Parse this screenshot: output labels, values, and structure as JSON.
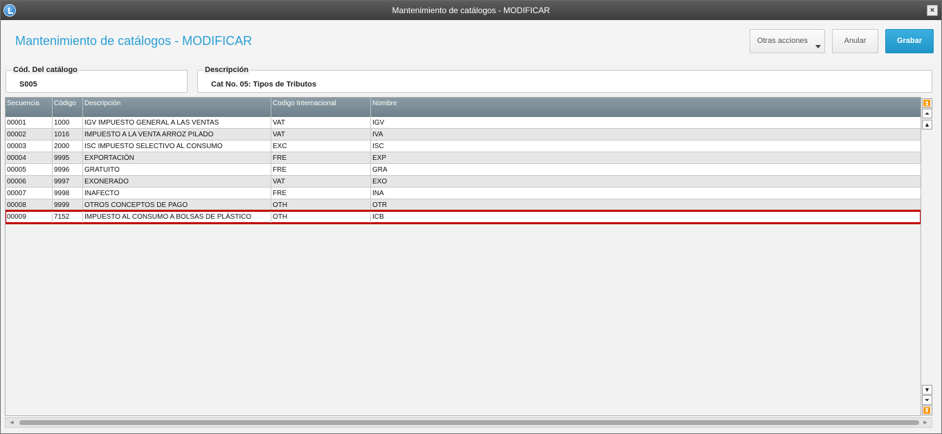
{
  "window": {
    "title": "Mantenimiento de catálogos - MODIFICAR",
    "close_label": "×"
  },
  "header": {
    "page_title": "Mantenimiento de catálogos - MODIFICAR",
    "otras_label": "Otras acciones",
    "anular_label": "Anular",
    "grabar_label": "Grabar",
    "accent_color": "#2a9fd6"
  },
  "form": {
    "codigo_label": "Cód. Del catálogo",
    "codigo_value": "S005",
    "descripcion_label": "Descripción",
    "descripcion_value": "Cat No. 05: Tipos de Tributos"
  },
  "grid": {
    "columns": [
      "Secuencia",
      "Código",
      "Descripción",
      "Codigo Internacional",
      "Nombre"
    ],
    "rows": [
      [
        "00001",
        "1000",
        "IGV IMPUESTO GENERAL A LAS VENTAS",
        "VAT",
        "IGV"
      ],
      [
        "00002",
        "1016",
        "IMPUESTO A LA VENTA ARROZ PILADO",
        "VAT",
        "IVA"
      ],
      [
        "00003",
        "2000",
        "ISC IMPUESTO SELECTIVO AL CONSUMO",
        "EXC",
        "ISC"
      ],
      [
        "00004",
        "9995",
        "EXPORTACIÓN",
        "FRE",
        "EXP"
      ],
      [
        "00005",
        "9996",
        "GRATUITO",
        "FRE",
        "GRA"
      ],
      [
        "00006",
        "9997",
        "EXONERADO",
        "VAT",
        "EXO"
      ],
      [
        "00007",
        "9998",
        "INAFECTO",
        "FRE",
        "INA"
      ],
      [
        "00008",
        "9999",
        "OTROS CONCEPTOS DE PAGO",
        "OTH",
        "OTR"
      ],
      [
        "00009",
        "7152",
        "IMPUESTO AL CONSUMO A BOLSAS DE PLÁSTICO",
        "OTH",
        "ICB"
      ]
    ],
    "selected_row_index": 8,
    "highlight_color": "#c00000"
  },
  "scrollbar": {
    "top_label": "⏫",
    "page_up_label": "⏶",
    "up_label": "▲",
    "down_label": "▼",
    "page_down_label": "⏷",
    "bottom_label": "⏬",
    "left_label": "◄",
    "right_label": "►"
  }
}
